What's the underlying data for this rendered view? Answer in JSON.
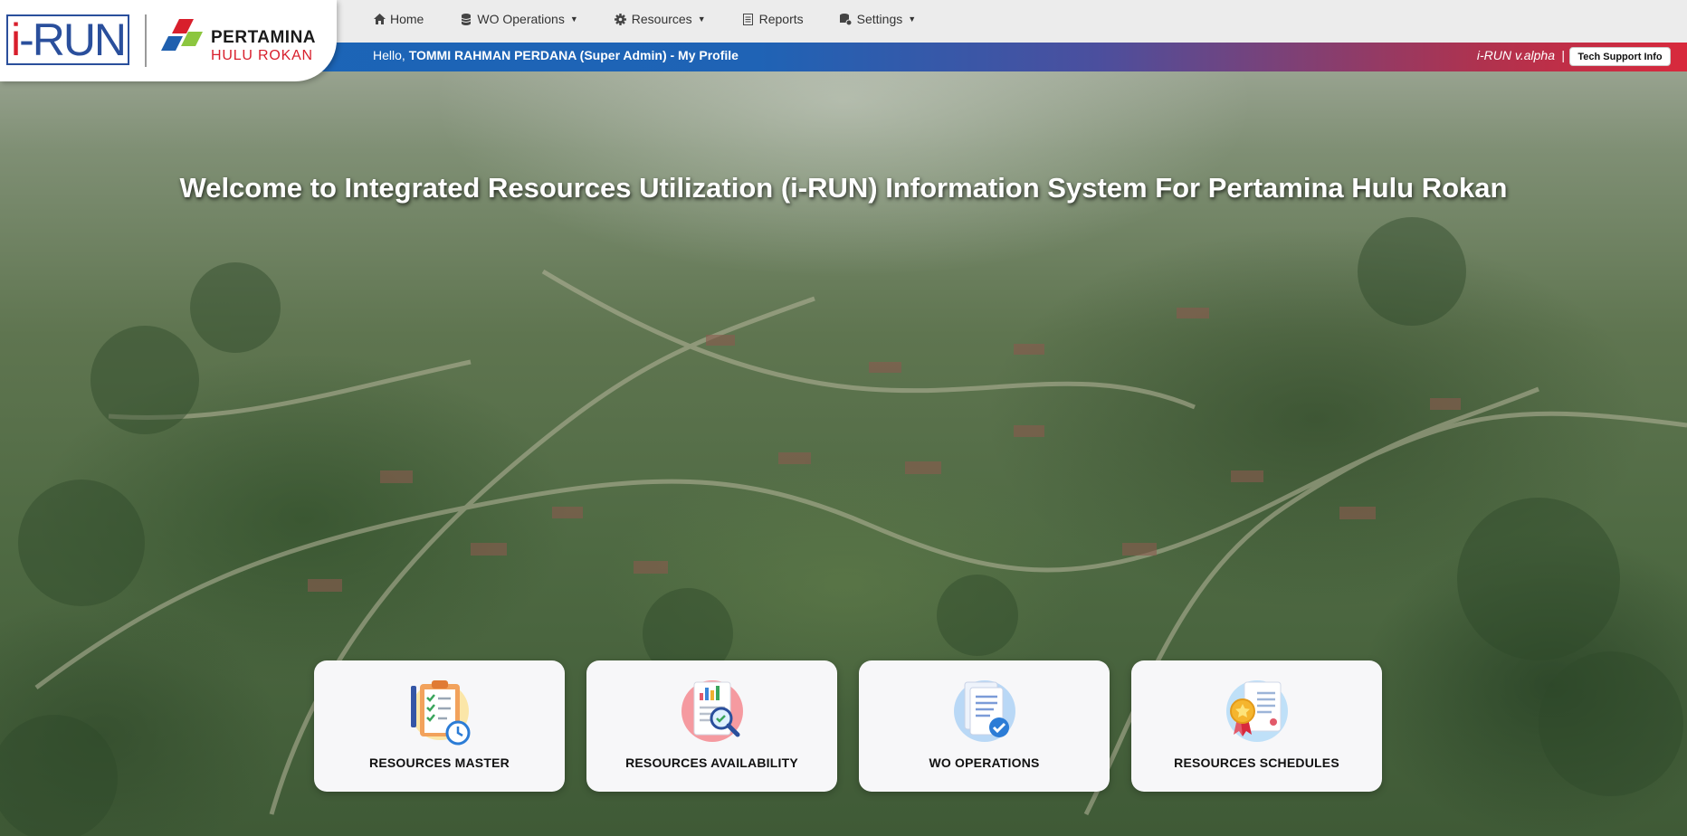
{
  "brand": {
    "app_logo_text_i": "i",
    "app_logo_text_rest": "-RUN",
    "company_name": "PERTAMINA",
    "company_sub": "HULU ROKAN",
    "colors": {
      "blue": "#2a4f9c",
      "red": "#d81f2c",
      "green": "#8cc63f"
    }
  },
  "nav": {
    "items": [
      {
        "label": "Home",
        "icon": "home-icon",
        "dropdown": false
      },
      {
        "label": "WO Operations",
        "icon": "database-icon",
        "dropdown": true
      },
      {
        "label": "Resources",
        "icon": "gear-icon",
        "dropdown": true
      },
      {
        "label": "Reports",
        "icon": "document-icon",
        "dropdown": false
      },
      {
        "label": "Settings",
        "icon": "database-settings-icon",
        "dropdown": true
      }
    ]
  },
  "userbar": {
    "greeting": "Hello,",
    "user": "TOMMI RAHMAN PERDANA (Super Admin) - My Profile",
    "version": "i-RUN v.alpha",
    "separator": "|",
    "tech_support": "Tech Support Info"
  },
  "hero": {
    "title": "Welcome to Integrated Resources Utilization (i-RUN) Information System For Pertamina Hulu Rokan"
  },
  "cards": [
    {
      "label": "RESOURCES MASTER",
      "icon": "clipboard-checklist-icon"
    },
    {
      "label": "RESOURCES AVAILABILITY",
      "icon": "report-magnifier-icon"
    },
    {
      "label": "WO OPERATIONS",
      "icon": "documents-check-icon"
    },
    {
      "label": "RESOURCES SCHEDULES",
      "icon": "certificate-icon"
    }
  ]
}
